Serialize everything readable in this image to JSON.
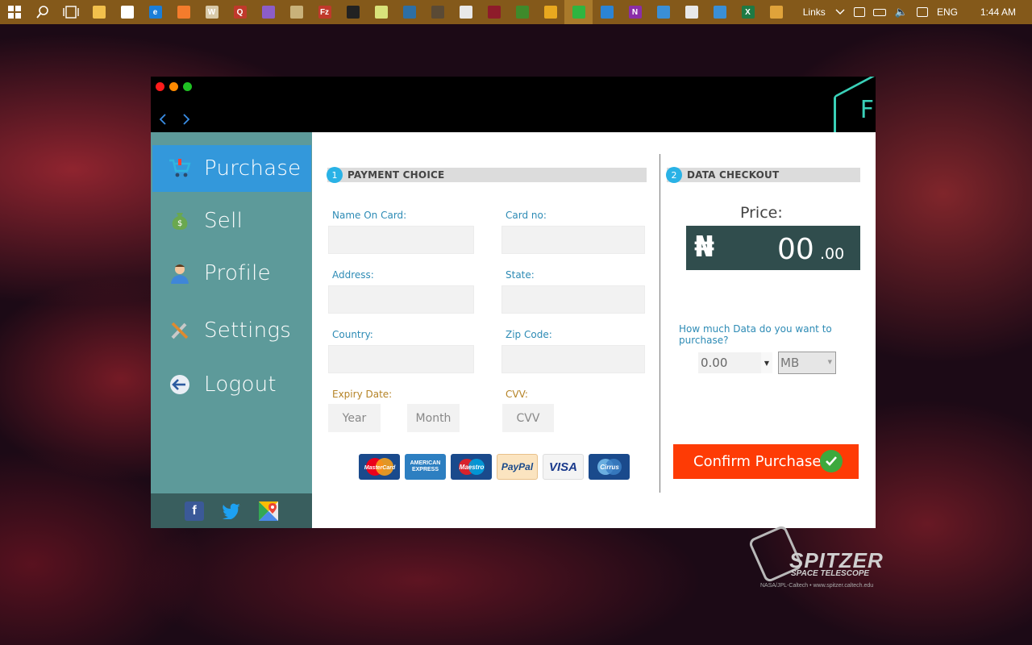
{
  "taskbar": {
    "start_icon": "windows-start-icon",
    "search_icon": "search-icon",
    "task_view_icon": "task-view-icon",
    "apps": [
      {
        "name": "file-explorer-icon",
        "glyph": "",
        "color": "#f2c04c"
      },
      {
        "name": "store-icon",
        "glyph": "",
        "color": "#ffffff"
      },
      {
        "name": "edge-icon",
        "glyph": "e",
        "color": "#1b7ed8"
      },
      {
        "name": "app-orange-icon",
        "glyph": "",
        "color": "#f47c2c"
      },
      {
        "name": "word-doc-icon",
        "glyph": "W",
        "color": "#d8c9a8"
      },
      {
        "name": "app-q-icon",
        "glyph": "Q",
        "color": "#c0392b"
      },
      {
        "name": "visual-studio-icon",
        "glyph": "",
        "color": "#8c5dc8"
      },
      {
        "name": "tools-icon",
        "glyph": "",
        "color": "#c9b27a"
      },
      {
        "name": "filezilla-icon",
        "glyph": "Fz",
        "color": "#c0392b"
      },
      {
        "name": "command-prompt-icon",
        "glyph": "",
        "color": "#222222"
      },
      {
        "name": "notepad-icon",
        "glyph": "",
        "color": "#d9e27a"
      },
      {
        "name": "xampp-icon",
        "glyph": "",
        "color": "#2d6fa5"
      },
      {
        "name": "app-circle-icon",
        "glyph": "",
        "color": "#5a4a35"
      },
      {
        "name": "app-gear-icon",
        "glyph": "",
        "color": "#e8e8e8"
      },
      {
        "name": "app-red-icon",
        "glyph": "",
        "color": "#8e1b2a"
      },
      {
        "name": "app-green-icon",
        "glyph": "",
        "color": "#3f8a2b"
      },
      {
        "name": "app-star-icon",
        "glyph": "",
        "color": "#e8a81f"
      },
      {
        "name": "line-icon",
        "glyph": "",
        "color": "#2fb540",
        "active": true
      },
      {
        "name": "app-contacts-icon",
        "glyph": "",
        "color": "#2b84d4"
      },
      {
        "name": "onenote-icon",
        "glyph": "N",
        "color": "#8b2ea8"
      },
      {
        "name": "app-card-icon",
        "glyph": "",
        "color": "#3a8fd6"
      },
      {
        "name": "calculator-icon",
        "glyph": "",
        "color": "#e8e8e8"
      },
      {
        "name": "app-chart-icon",
        "glyph": "",
        "color": "#3a8fd6"
      },
      {
        "name": "excel-icon",
        "glyph": "X",
        "color": "#1e7a44"
      },
      {
        "name": "app-photos-icon",
        "glyph": "",
        "color": "#e0a33a"
      }
    ],
    "tray": {
      "links_label": "Links",
      "language": "ENG",
      "time": "1:44 AM"
    }
  },
  "window": {
    "traffic_lights": {
      "close": "#ff1b1b",
      "minimize": "#ff8a00",
      "maximize": "#1fc123"
    },
    "nav_back": "‹",
    "nav_forward": "›",
    "brand_letter": "F",
    "accent": "#3ad0b8"
  },
  "sidebar": {
    "items": [
      {
        "label": "Purchase",
        "icon": "cart-icon",
        "active": true
      },
      {
        "label": "Sell",
        "icon": "money-bag-icon"
      },
      {
        "label": "Profile",
        "icon": "user-icon"
      },
      {
        "label": "Settings",
        "icon": "tools-icon"
      },
      {
        "label": "Logout",
        "icon": "logout-icon"
      }
    ],
    "social": [
      {
        "name": "facebook-icon",
        "glyph": "f",
        "color": "#3b5998"
      },
      {
        "name": "twitter-icon",
        "glyph": "t",
        "color": "#1da1f2"
      },
      {
        "name": "google-maps-icon",
        "glyph": "G",
        "color": "#34a853"
      }
    ]
  },
  "payment": {
    "step": "1",
    "title": "PAYMENT CHOICE",
    "fields": {
      "name_on_card": {
        "label": "Name On Card:",
        "value": ""
      },
      "card_no": {
        "label": "Card no:",
        "value": ""
      },
      "address": {
        "label": "Address:",
        "value": ""
      },
      "state": {
        "label": "State:",
        "value": ""
      },
      "country": {
        "label": "Country:",
        "value": ""
      },
      "zip_code": {
        "label": "Zip Code:",
        "value": ""
      }
    },
    "expiry": {
      "label": "Expiry Date:",
      "year_placeholder": "Year",
      "month_placeholder": "Month"
    },
    "cvv": {
      "label": "CVV:",
      "placeholder": "CVV"
    },
    "cards": [
      {
        "name": "mastercard-logo",
        "text": "MasterCard",
        "bg": "#1a4a8c",
        "fg": "#ffffff"
      },
      {
        "name": "american-express-logo",
        "text": "AMERICAN EXPRESS",
        "bg": "#2d7fc1",
        "fg": "#ffffff"
      },
      {
        "name": "maestro-logo",
        "text": "Maestro",
        "bg": "#1a4a8c",
        "fg": "#ffffff"
      },
      {
        "name": "paypal-logo",
        "text": "PayPal",
        "bg": "#fbe4c0",
        "fg": "#1a4a8c"
      },
      {
        "name": "visa-logo",
        "text": "VISA",
        "bg": "#f4f4f4",
        "fg": "#1a3a8c"
      },
      {
        "name": "cirrus-logo",
        "text": "Cirrus",
        "bg": "#1a4a8c",
        "fg": "#ffffff"
      }
    ]
  },
  "checkout": {
    "step": "2",
    "title": "DATA CHECKOUT",
    "price_label": "Price:",
    "currency_symbol": "₦",
    "price_integer": "00",
    "price_decimal": ".00",
    "question": "How much Data do you want to purchase?",
    "quantity": "0.00",
    "unit": "MB",
    "confirm_label": "Confirm Purchase",
    "confirm_icon": "checkmark-icon"
  },
  "wallpaper": {
    "logo_title": "SPITZER",
    "logo_subtitle": "SPACE TELESCOPE",
    "credit": "NASA/JPL-Caltech  •  www.spitzer.caltech.edu"
  }
}
